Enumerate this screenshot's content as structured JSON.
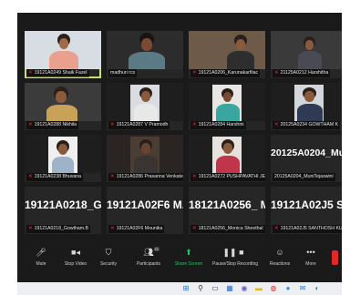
{
  "app": {
    "title": "Zoom Meeting"
  },
  "participants": [
    {
      "label": "19121A0249 Shaik Fazel",
      "video": true,
      "active": true
    },
    {
      "label": "madhuri rcs",
      "video": true
    },
    {
      "label": "19121A0206_Karunakarfilac",
      "video": true
    },
    {
      "label": "21125A0212 Harshitha",
      "video": true
    },
    {
      "label": "19121A0288 Nikhila",
      "video": true
    },
    {
      "label": "19121A0287 V Pramodh",
      "video": true
    },
    {
      "label": "19121A0284 Harshini",
      "video": true
    },
    {
      "label": "20125A0234 GOWTHAM K",
      "video": true
    },
    {
      "label": "19121A0238 Bhuvana",
      "video": true
    },
    {
      "label": "19121A0286 Prasanna Venkate...",
      "video": true
    },
    {
      "label": "19121A0272 PUSHPAVATHI JETTI",
      "video": true
    },
    {
      "label": "20125A0204_MuniTejaswini",
      "display": "20125A0204_MuniTejaswini",
      "video": false
    },
    {
      "label": "19121A0218_Gowtham.B",
      "display": "19121A0218_G...",
      "video": false
    },
    {
      "label": "19121A02F6 Mounika",
      "display": "19121A02F6  M...",
      "video": false
    },
    {
      "label": "18121A0256_Monica Sheethal",
      "display": "18121A0256_  M...",
      "video": false
    },
    {
      "label": "19121A02J5 SANTHOSH KUMAR",
      "display": "19121A02J5  SA",
      "video": false
    }
  ],
  "toolbar": {
    "mute": "Mute",
    "stop_video": "Stop Video",
    "security": "Security",
    "participants": "Participants",
    "participants_count": "21",
    "share_screen": "Share Screen",
    "pause_recording": "Pause/Stop Recording",
    "reactions": "Reactions",
    "more": "More"
  },
  "colors": {
    "background": "#1a1a1a",
    "tile": "#262626",
    "active_speaker": "#c7e36a",
    "share_green": "#22c55e",
    "mic_off_red": "#e8333a",
    "end_red": "#e02828"
  }
}
